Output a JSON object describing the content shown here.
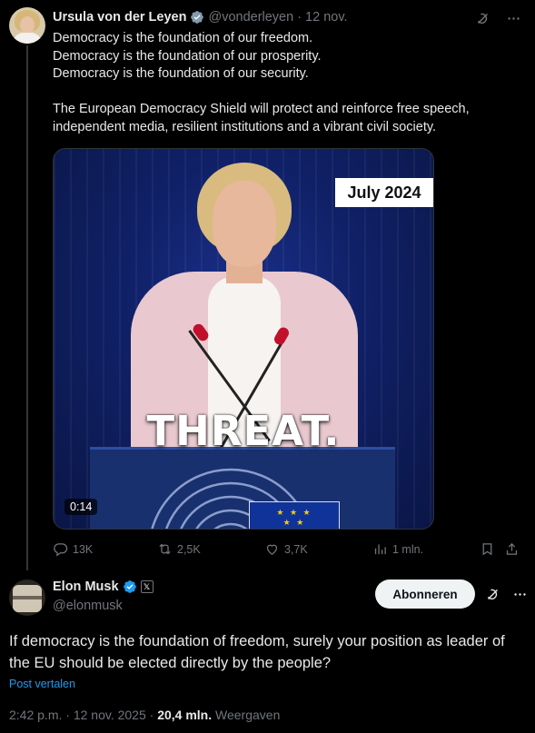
{
  "parent_tweet": {
    "author_name": "Ursula von der Leyen",
    "handle": "@vonderleyen",
    "separator": "·",
    "date": "12 nov.",
    "lines": [
      "Democracy is the foundation of our freedom.",
      "Democracy is the foundation of our prosperity.",
      "Democracy is the foundation of our security.",
      "",
      "The European Democracy Shield will protect and reinforce free speech,",
      "independent media, resilient institutions and a vibrant civil society."
    ],
    "media": {
      "date_badge": "July 2024",
      "caption": "THREAT.",
      "duration": "0:14"
    },
    "stats": {
      "replies": "13K",
      "reposts": "2,5K",
      "likes": "3,7K",
      "views": "1 mln."
    }
  },
  "main_tweet": {
    "author_name": "Elon Musk",
    "handle": "@elonmusk",
    "affiliate_badge": "𝕏",
    "subscribe_label": "Abonneren",
    "text": "If democracy is the foundation of freedom, surely your position as leader of the EU should be elected directly by the people?",
    "translate_label": "Post vertalen",
    "time": "2:42 p.m.",
    "date": "12 nov. 2025",
    "sep": "·",
    "views_count": "20,4 mln.",
    "views_label": "Weergaven"
  },
  "icons": [
    "verified-badge-icon",
    "grok-icon",
    "more-icon",
    "reply-icon",
    "repost-icon",
    "like-icon",
    "views-icon",
    "bookmark-icon",
    "share-icon"
  ],
  "colors": {
    "accent": "#1d9bf0",
    "muted": "#71767b",
    "text": "#e7e9ea",
    "background": "#000000"
  }
}
